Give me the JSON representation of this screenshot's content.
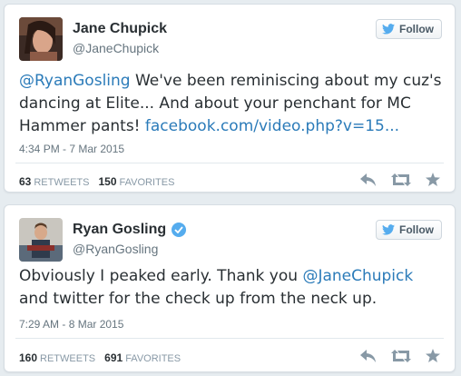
{
  "tweets": [
    {
      "name": "Jane Chupick",
      "handle": "@JaneChupick",
      "verified": false,
      "follow_label": "Follow",
      "text_parts": {
        "mention": "@RyanGosling",
        "body": " We've been reminiscing about my cuz's dancing at Elite... And about your penchant for MC Hammer pants! ",
        "link": "facebook.com/video.php?v=15..."
      },
      "timestamp": "4:34 PM - 7 Mar 2015",
      "retweets": "63",
      "retweets_label": "RETWEETS",
      "favorites": "150",
      "favorites_label": "FAVORITES"
    },
    {
      "name": "Ryan Gosling",
      "handle": "@RyanGosling",
      "verified": true,
      "follow_label": "Follow",
      "text_parts": {
        "before": "Obviously I peaked early. Thank you ",
        "mention": "@JaneChupick",
        "after": " and twitter for the check up from the neck up."
      },
      "timestamp": "7:29 AM - 8 Mar 2015",
      "retweets": "160",
      "retweets_label": "RETWEETS",
      "favorites": "691",
      "favorites_label": "FAVORITES"
    }
  ],
  "icons": {
    "follow": "twitter-bird-icon",
    "verified": "verified-badge-icon",
    "reply": "reply-icon",
    "retweet": "retweet-icon",
    "favorite": "star-icon"
  },
  "colors": {
    "link": "#2b7bb9",
    "verified": "#55acee",
    "action_icon": "#8899a6"
  }
}
